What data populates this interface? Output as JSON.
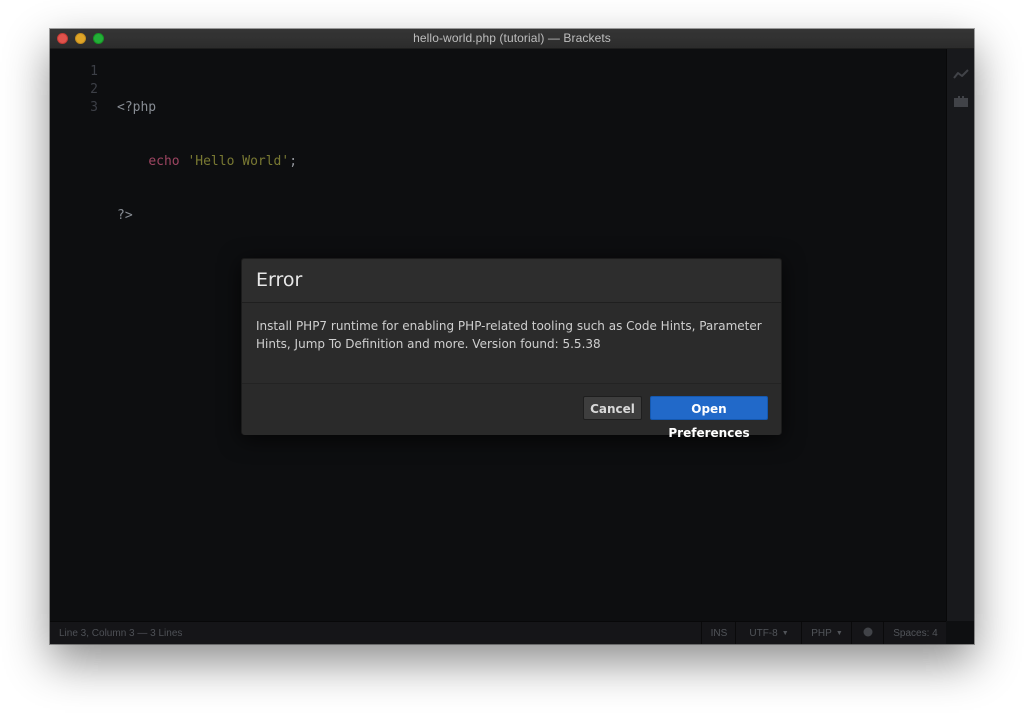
{
  "window": {
    "title": "hello-world.php (tutorial) — Brackets"
  },
  "editor": {
    "line_numbers": [
      "1",
      "2",
      "3"
    ],
    "line1": {
      "tag": "<?php"
    },
    "line2": {
      "indent": "    ",
      "keyword": "echo",
      "space": " ",
      "string": "'Hello World'",
      "punct": ";"
    },
    "line3": {
      "tag": "?>"
    }
  },
  "statusbar": {
    "cursor": "Line 3, Column 3 — 3 Lines",
    "mode": "INS",
    "encoding": "UTF-8",
    "language": "PHP",
    "indent": "Spaces: 4"
  },
  "dialog": {
    "title": "Error",
    "message": "Install PHP7 runtime for enabling PHP-related tooling such as Code Hints, Parameter Hints, Jump To Definition and more. Version found: 5.5.38",
    "cancel_label": "Cancel",
    "primary_label": "Open Preferences"
  },
  "icons": {
    "caret": "▼"
  },
  "colors": {
    "primary_button": "#2169c9",
    "keyword": "#b34f6f",
    "string": "#8a8a3a"
  }
}
